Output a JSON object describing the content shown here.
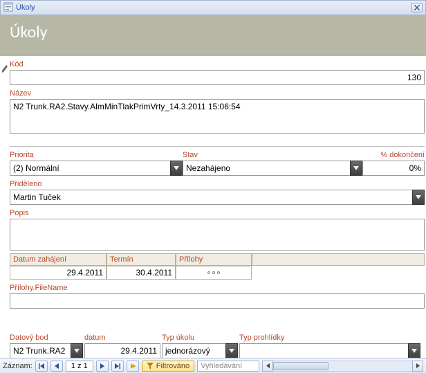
{
  "window": {
    "title": "Úkoly",
    "close_icon": "✕"
  },
  "header": {
    "title": "Úkoly"
  },
  "fields": {
    "kod": {
      "label": "Kód",
      "value": "130"
    },
    "nazev": {
      "label": "Název",
      "value": "N2 Trunk.RA2.Stavy.AlmMinTlakPrimVrty_14.3.2011 15:06:54"
    },
    "priorita": {
      "label": "Priorita",
      "value": "(2) Normální"
    },
    "stav": {
      "label": "Stav",
      "value": "Nezahájeno"
    },
    "dokonceni": {
      "label": "% dokončení",
      "value": "0%"
    },
    "prideleno": {
      "label": "Přiděleno",
      "value": "Martin Tuček"
    },
    "popis": {
      "label": "Popis",
      "value": ""
    },
    "prilohy_filename": {
      "label": "Přílohy.FileName",
      "value": ""
    }
  },
  "table": {
    "headers": {
      "zahajeni": "Datum zahájení",
      "termin": "Termín",
      "prilohy": "Přílohy"
    },
    "row": {
      "zahajeni": "29.4.2011",
      "termin": "30.4.2011",
      "prilohy": ""
    }
  },
  "bottom": {
    "datovy_bod": {
      "label": "Datový bod",
      "value": "N2 Trunk.RA2"
    },
    "datum": {
      "label": "datum",
      "value": "29.4.2011"
    },
    "typ_ukolu": {
      "label": "Typ úkolu",
      "value": "jednorázový"
    },
    "typ_prohlidky": {
      "label": "Typ prohlídky",
      "value": ""
    }
  },
  "nav": {
    "label": "Záznam:",
    "position": "1 z 1",
    "filter": "Filtrováno",
    "search": "Vyhledávání"
  }
}
